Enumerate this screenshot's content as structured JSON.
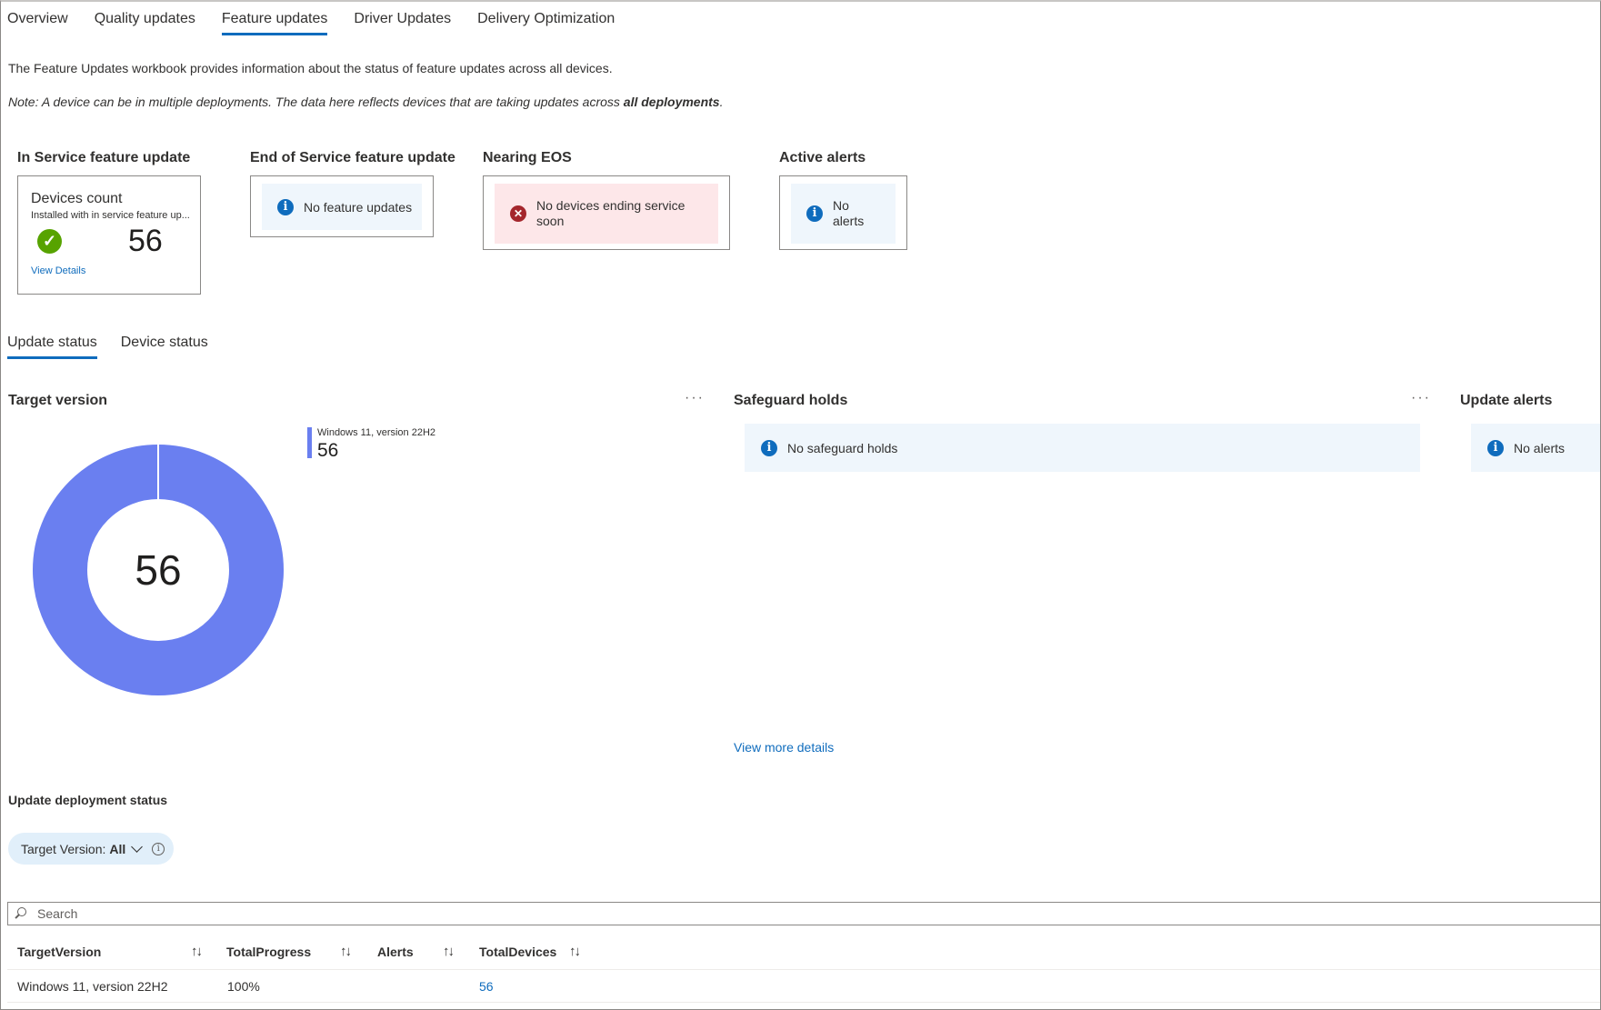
{
  "tabs": {
    "items": [
      {
        "label": "Overview"
      },
      {
        "label": "Quality updates"
      },
      {
        "label": "Feature updates",
        "active": true
      },
      {
        "label": "Driver Updates"
      },
      {
        "label": "Delivery Optimization"
      }
    ]
  },
  "intro": "The Feature Updates workbook provides information about the status of feature updates across all devices.",
  "note": {
    "prefix": "Note: A device can be in multiple deployments. The data here reflects devices that are taking updates across ",
    "bold": "all deployments",
    "suffix": "."
  },
  "tiles": {
    "in_service": {
      "heading": "In Service feature update",
      "title": "Devices count",
      "subtitle": "Installed with in service feature up...",
      "count": "56",
      "link": "View Details",
      "icon": "check-icon"
    },
    "end_of_service": {
      "heading": "End of Service feature update",
      "message": "No feature updates",
      "icon": "info-icon"
    },
    "nearing_eos": {
      "heading": "Nearing EOS",
      "message_line1": "No devices ending service",
      "message_line2": "soon",
      "icon": "error-icon"
    },
    "active_alerts": {
      "heading": "Active alerts",
      "message_line1": "No",
      "message_line2": "alerts",
      "icon": "info-icon"
    }
  },
  "sub_tabs": {
    "items": [
      {
        "label": "Update status",
        "active": true
      },
      {
        "label": "Device status"
      }
    ]
  },
  "target_version": {
    "heading": "Target version",
    "more": "···",
    "center_value": "56"
  },
  "chart_data": {
    "type": "pie",
    "donut": true,
    "categories": [
      "Windows 11, version 22H2"
    ],
    "values": [
      56
    ],
    "total": 56,
    "colors": [
      "#6a7ff0"
    ],
    "legend": [
      {
        "label": "Windows 11, version 22H2",
        "value": "56"
      }
    ],
    "legend_position": "top-right"
  },
  "safeguard": {
    "heading": "Safeguard holds",
    "more": "···",
    "message": "No safeguard holds"
  },
  "update_alerts": {
    "heading": "Update alerts",
    "message": "No alerts"
  },
  "view_more": "View more details",
  "deployment": {
    "heading": "Update deployment status",
    "filter_label": "Target Version:",
    "filter_value": "All",
    "search_placeholder": "Search"
  },
  "table": {
    "columns": [
      "TargetVersion",
      "TotalProgress",
      "Alerts",
      "TotalDevices"
    ],
    "rows": [
      {
        "TargetVersion": "Windows 11, version 22H2",
        "TotalProgress": "100%",
        "Alerts": "",
        "TotalDevices": "56"
      }
    ]
  },
  "colors": {
    "accent": "#0f6cbd",
    "donut": "#6a7ff0",
    "success": "#57a300",
    "error": "#a4262c",
    "info_bg": "#eff6fc",
    "error_bg": "#fde7e9"
  }
}
